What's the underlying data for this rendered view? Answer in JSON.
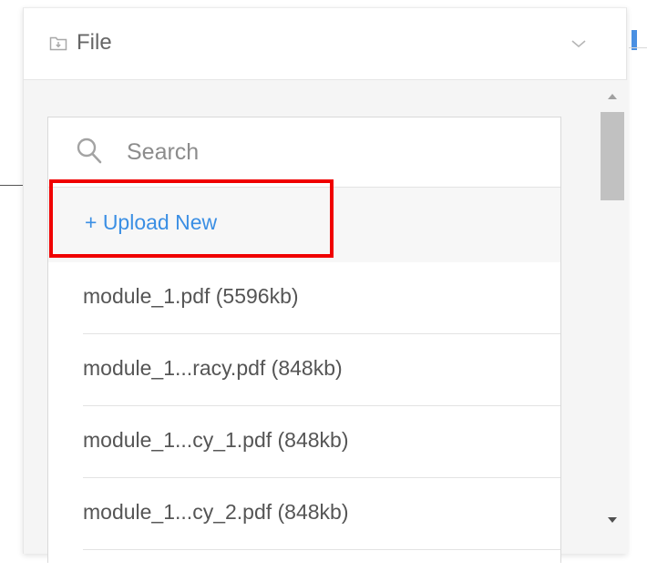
{
  "dropdown": {
    "header_label": "File",
    "header_icon": "folder-icon",
    "chevron_icon": "chevron-down-icon"
  },
  "search": {
    "placeholder": "Search",
    "value": "",
    "icon": "search-icon"
  },
  "upload": {
    "label": "+ Upload New",
    "color": "#3b8fe4",
    "highlight_color": "#f00000"
  },
  "files": [
    {
      "label": "module_1.pdf (5596kb)"
    },
    {
      "label": "module_1...racy.pdf (848kb)"
    },
    {
      "label": "module_1...cy_1.pdf (848kb)"
    },
    {
      "label": "module_1...cy_2.pdf (848kb)"
    }
  ],
  "scrollbar": {
    "up_icon": "scroll-up-arrow-icon",
    "down_icon": "scroll-down-arrow-icon"
  }
}
